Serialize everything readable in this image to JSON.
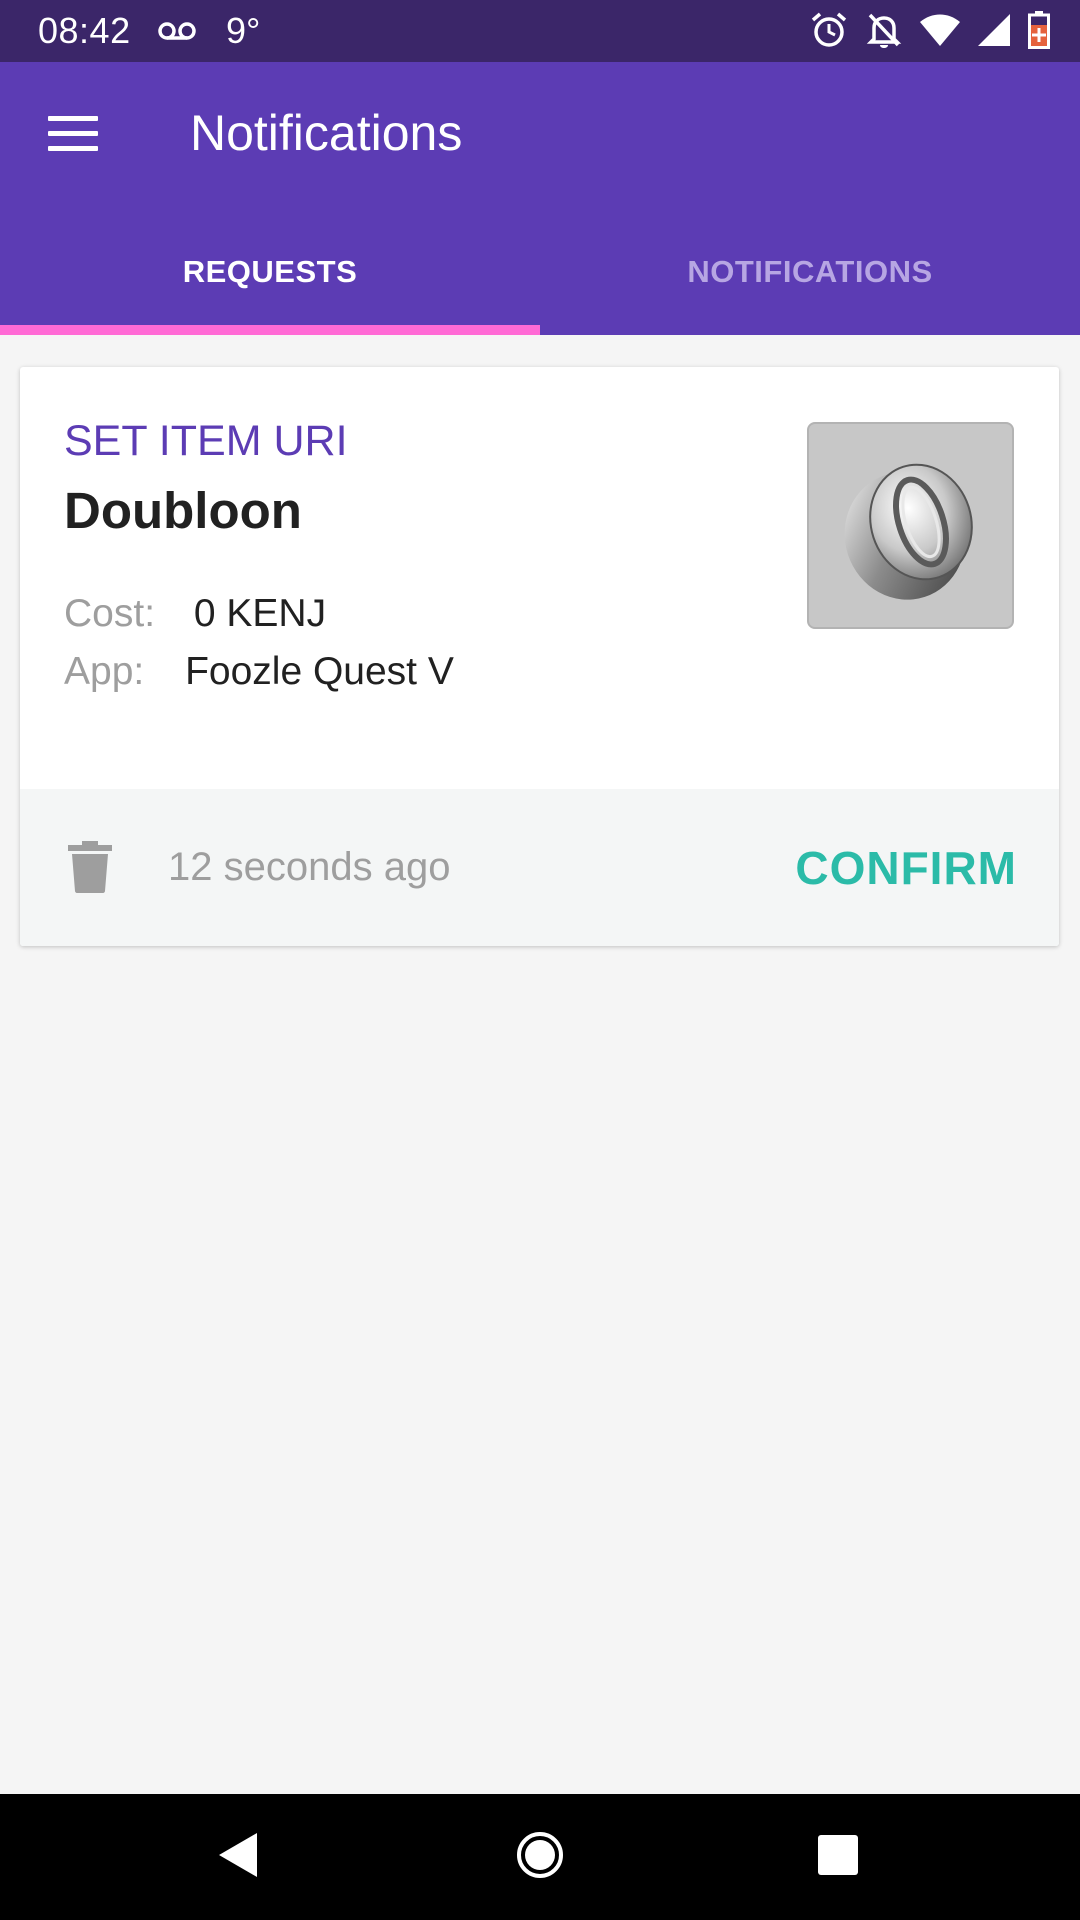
{
  "status_bar": {
    "time": "08:42",
    "temperature": "9°",
    "icons": [
      "voicemail-icon",
      "alarm-icon",
      "notifications-off-icon",
      "wifi-icon",
      "signal-icon",
      "battery-icon"
    ]
  },
  "app_bar": {
    "title": "Notifications",
    "menu_icon": "hamburger-menu-icon",
    "tabs": [
      {
        "label": "REQUESTS",
        "active": true
      },
      {
        "label": "NOTIFICATIONS",
        "active": false
      }
    ]
  },
  "request_card": {
    "type": "SET ITEM URI",
    "item_name": "Doubloon",
    "cost_label": "Cost:",
    "cost_value": "0 KENJ",
    "app_label": "App:",
    "app_value": "Foozle Quest V",
    "image_icon": "coin-icon",
    "timestamp": "12 seconds ago",
    "confirm_label": "CONFIRM",
    "delete_icon": "trash-icon"
  },
  "nav_bar": {
    "icons": [
      "back-icon",
      "home-icon",
      "recents-icon"
    ]
  },
  "colors": {
    "status_bar": "#3b2669",
    "primary": "#5c3cb4",
    "tab_indicator": "#ff6ad5",
    "accent": "#2bbba8",
    "background": "#f5f5f5"
  }
}
